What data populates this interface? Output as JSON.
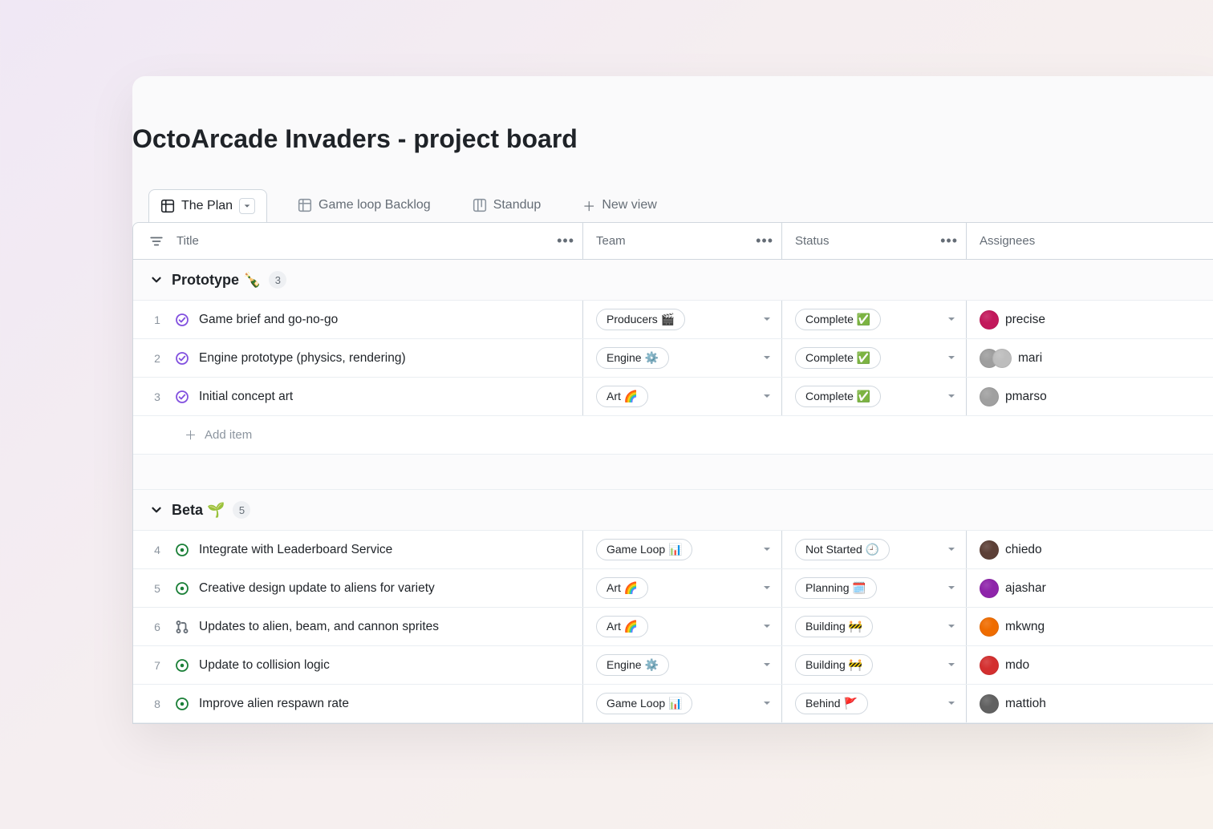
{
  "page_title": "OctoArcade Invaders - project board",
  "views": {
    "active": {
      "label": "The Plan"
    },
    "others": [
      {
        "label": "Game loop Backlog",
        "icon": "table-icon"
      },
      {
        "label": "Standup",
        "icon": "board-icon"
      }
    ],
    "new_view_label": "New view"
  },
  "columns": {
    "title": "Title",
    "team": "Team",
    "status": "Status",
    "assignees": "Assignees"
  },
  "add_item_label": "Add item",
  "groups": [
    {
      "name": "Prototype 🍾",
      "count": "3",
      "rows": [
        {
          "num": "1",
          "icon": "closed",
          "title": "Game brief and go-no-go",
          "team": "Producers 🎬",
          "status": "Complete ✅",
          "assignees": [
            {
              "color": "#c2185b"
            }
          ],
          "assignee_label": "precise"
        },
        {
          "num": "2",
          "icon": "closed",
          "title": "Engine prototype (physics, rendering)",
          "team": "Engine ⚙️",
          "status": "Complete ✅",
          "assignees": [
            {
              "color": "#9e9e9e"
            },
            {
              "color": "#bdbdbd"
            }
          ],
          "assignee_label": "mari"
        },
        {
          "num": "3",
          "icon": "closed",
          "title": "Initial concept art",
          "team": "Art 🌈",
          "status": "Complete ✅",
          "assignees": [
            {
              "color": "#a0a0a0"
            }
          ],
          "assignee_label": "pmarso"
        }
      ]
    },
    {
      "name": "Beta 🌱",
      "count": "5",
      "rows": [
        {
          "num": "4",
          "icon": "open",
          "title": "Integrate with Leaderboard Service",
          "team": "Game Loop 📊",
          "status": "Not Started 🕘",
          "assignees": [
            {
              "color": "#5d4037"
            }
          ],
          "assignee_label": "chiedo"
        },
        {
          "num": "5",
          "icon": "open",
          "title": "Creative design update to aliens for variety",
          "team": "Art 🌈",
          "status": "Planning 🗓️",
          "assignees": [
            {
              "color": "#8e24aa"
            }
          ],
          "assignee_label": "ajashar"
        },
        {
          "num": "6",
          "icon": "pr",
          "title": "Updates to alien, beam, and cannon sprites",
          "team": "Art 🌈",
          "status": "Building 🚧",
          "assignees": [
            {
              "color": "#ef6c00"
            }
          ],
          "assignee_label": "mkwng"
        },
        {
          "num": "7",
          "icon": "open",
          "title": "Update to collision logic",
          "team": "Engine ⚙️",
          "status": "Building 🚧",
          "assignees": [
            {
              "color": "#d32f2f"
            }
          ],
          "assignee_label": "mdo"
        },
        {
          "num": "8",
          "icon": "open",
          "title": "Improve alien respawn rate",
          "team": "Game Loop 📊",
          "status": "Behind 🚩",
          "assignees": [
            {
              "color": "#616161"
            }
          ],
          "assignee_label": "mattioh"
        }
      ]
    }
  ]
}
